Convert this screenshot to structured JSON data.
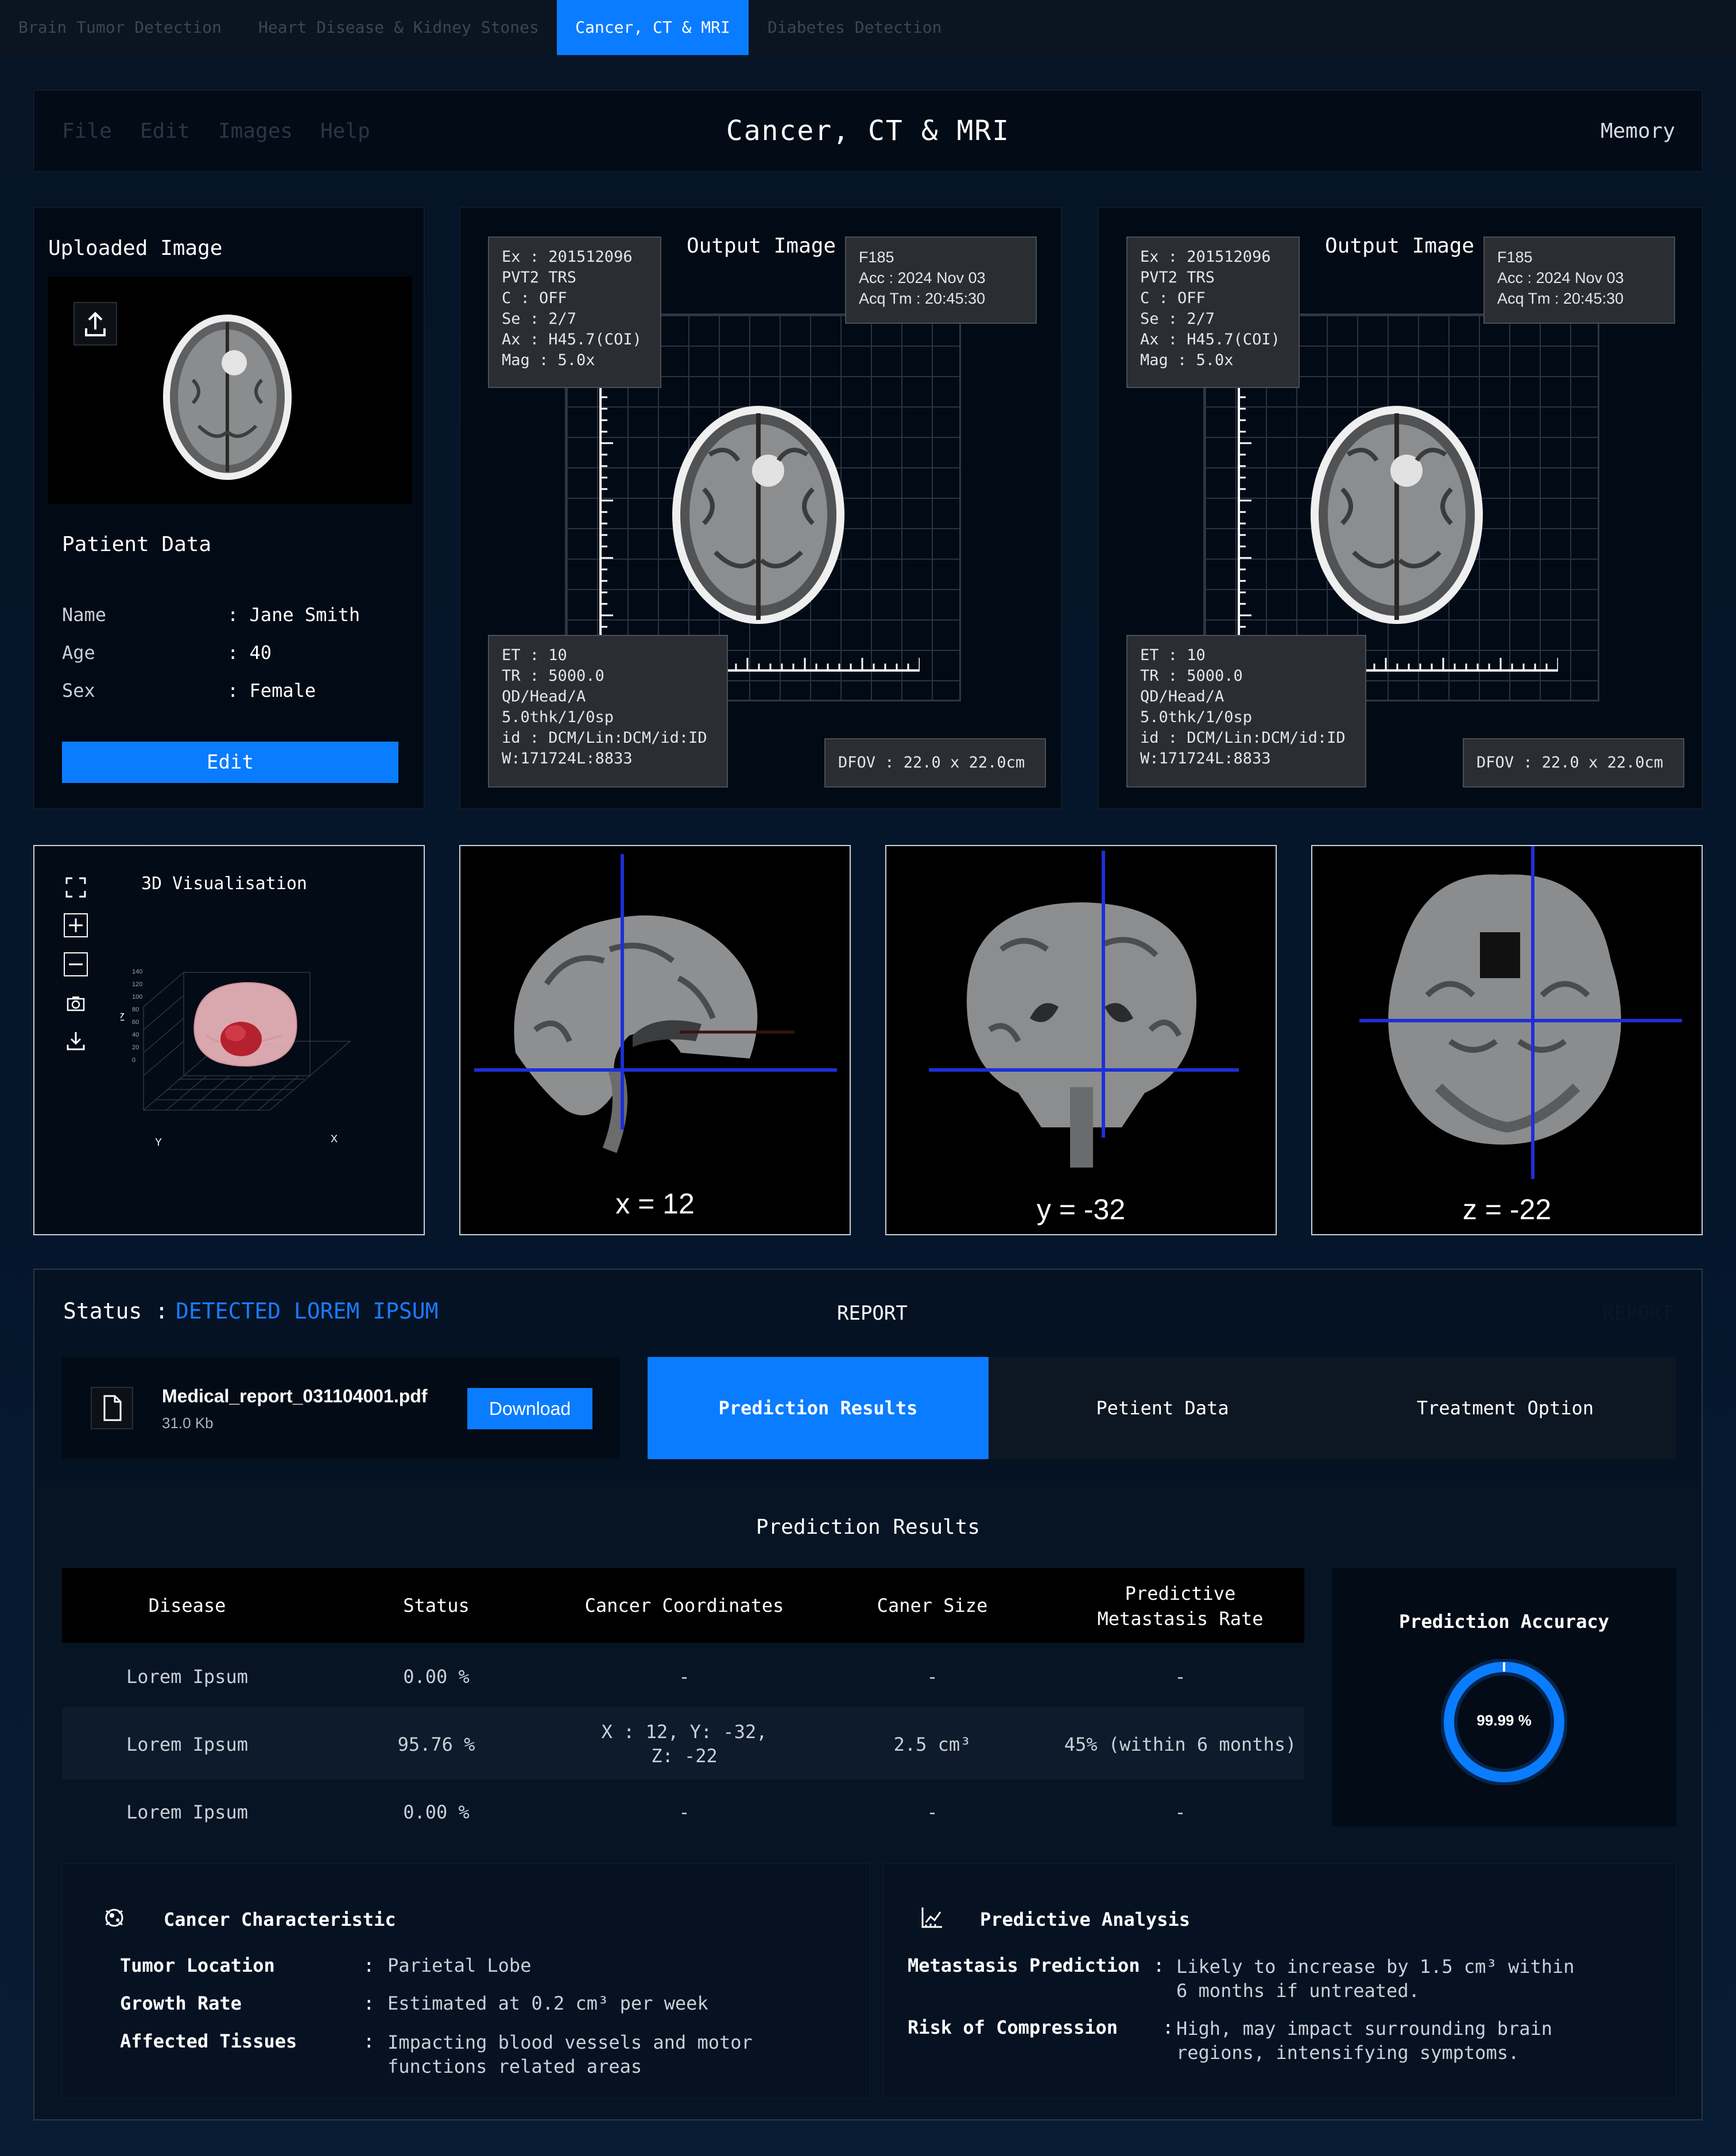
{
  "top_tabs": [
    {
      "label": "Brain Tumor Detection",
      "active": false
    },
    {
      "label": "Heart Disease & Kidney Stones",
      "active": false
    },
    {
      "label": "Cancer, CT & MRI",
      "active": true
    },
    {
      "label": "Diabetes Detection",
      "active": false
    }
  ],
  "menu": {
    "items": [
      "File",
      "Edit",
      "Images",
      "Help"
    ],
    "title": "Cancer, CT & MRI",
    "right": "Memory"
  },
  "upload": {
    "title": "Uploaded Image"
  },
  "patient": {
    "title": "Patient Data",
    "fields": [
      {
        "label": "Name",
        "value": ": Jane Smith"
      },
      {
        "label": "Age",
        "value": ": 40"
      },
      {
        "label": "Sex",
        "value": ": Female"
      }
    ],
    "edit_label": "Edit"
  },
  "output": {
    "title": "Output Image",
    "info_tl": "Ex : 201512096\nPVT2 TRS\nC : OFF\nSe : 2/7\nAx : H45.7(COI)\nMag : 5.0x",
    "info_tr": "F185\nAcc : 2024 Nov 03\nAcq Tm : 20:45:30",
    "info_bl": "ET : 10\nTR : 5000.0\nQD/Head/A\n5.0thk/1/0sp\nid : DCM/Lin:DCM/id:ID\nW:171724L:8833",
    "info_br": "DFOV : 22.0 x 22.0cm"
  },
  "viz": {
    "title": "3D Visualisation",
    "axis_z": "Z",
    "axis_y": "Y",
    "axis_x": "X",
    "z_ticks": [
      "140",
      "120",
      "100",
      "80",
      "60",
      "40",
      "20",
      "0"
    ]
  },
  "slices": [
    {
      "label": "x = 12"
    },
    {
      "label": "y = -32"
    },
    {
      "label": "z = -22"
    }
  ],
  "report": {
    "status_label": "Status :",
    "status_value": "DETECTED LOREM IPSUM",
    "title": "REPORT",
    "ghost": "REPORT",
    "file_name": "Medical_report_031104001.pdf",
    "file_size": "31.0 Kb",
    "download_label": "Download",
    "tabs": [
      {
        "label": "Prediction Results",
        "active": true
      },
      {
        "label": "Petient Data",
        "active": false
      },
      {
        "label": "Treatment Option",
        "active": false
      }
    ],
    "section_title": "Prediction Results",
    "table": {
      "headers": [
        "Disease",
        "Status",
        "Cancer Coordinates",
        "Caner Size",
        "Predictive Metastasis Rate"
      ],
      "rows": [
        [
          "Lorem Ipsum",
          "0.00 %",
          "-",
          "-",
          "-"
        ],
        [
          "Lorem Ipsum",
          "95.76 %",
          "X : 12, Y:  -32, Z: -22",
          "2.5 cm³",
          "45% (within 6 months)"
        ],
        [
          "Lorem Ipsum",
          "0.00 %",
          "-",
          "-",
          "-"
        ]
      ]
    },
    "accuracy": {
      "title": "Prediction Accuracy",
      "value_text": "99.99 %",
      "value": 99.99
    }
  },
  "characteristic": {
    "title": "Cancer Characteristic",
    "rows": [
      {
        "label": "Tumor Location",
        "value": "Parietal Lobe"
      },
      {
        "label": "Growth Rate",
        "value": "Estimated at 0.2 cm³ per week"
      },
      {
        "label": "Affected Tissues",
        "value": "Impacting blood vessels and motor\nfunctions related areas"
      }
    ]
  },
  "analysis": {
    "title": "Predictive Analysis",
    "rows": [
      {
        "label": "Metastasis Prediction",
        "value": "Likely to increase by 1.5 cm³ within\n6 months if untreated."
      },
      {
        "label": "Risk of Compression",
        "value": "High, may impact surrounding brain\nregions, intensifying symptoms."
      }
    ]
  },
  "colors": {
    "accent": "#0a7cff",
    "status": "#1a7bff",
    "bg": "#061426",
    "panel": "#020b16"
  }
}
